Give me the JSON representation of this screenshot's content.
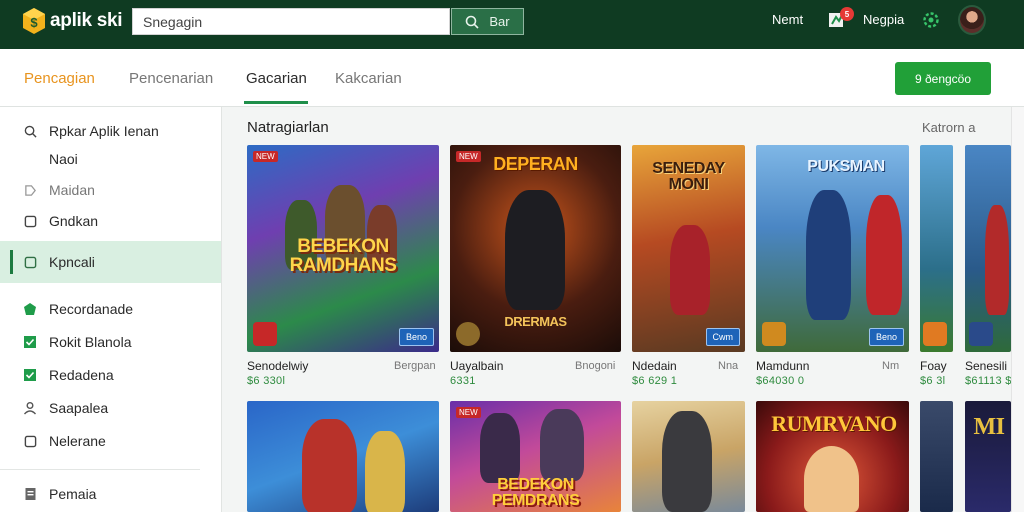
{
  "app": {
    "name": "aplik ski"
  },
  "search": {
    "value": "Snegagin",
    "button_label": "Bar"
  },
  "topnav": {
    "link1": "Nemt",
    "notif_count": "5",
    "link2": "Negpia"
  },
  "tabs": [
    {
      "label": "Pencagian"
    },
    {
      "label": "Pencenarian"
    },
    {
      "label": "Gacarian"
    },
    {
      "label": "Kakcarian"
    }
  ],
  "cta_label": "9 ðengcöo",
  "sidebar": {
    "items": [
      {
        "label": "Rpkar Aplik Ienan",
        "icon": "search-icon"
      },
      {
        "label": "Naoi",
        "icon": ""
      },
      {
        "label": "Maidan",
        "icon": "tag-icon"
      },
      {
        "label": "Gndkan",
        "icon": "square-icon"
      },
      {
        "label": "Kpncali",
        "icon": "square-icon"
      },
      {
        "label": "Recordanade",
        "icon": "shield-icon"
      },
      {
        "label": "Rokit Blanola",
        "icon": "square-check-icon"
      },
      {
        "label": "Redadena",
        "icon": "square-check-icon"
      },
      {
        "label": "Saapalea",
        "icon": "person-icon"
      },
      {
        "label": "Nelerane",
        "icon": "square-icon"
      },
      {
        "label": "Pemaia",
        "icon": "doc-icon"
      }
    ]
  },
  "section": {
    "title": "Natragiarlan",
    "see_all": "Katrorn a"
  },
  "games_row1": [
    {
      "art_title": "BEBEKON RAMDHANS",
      "tag": "NEW",
      "badge": "Beno",
      "name": "Senodelwiy",
      "sub": "Bergpan",
      "price": "$6 330l"
    },
    {
      "art_title": "DEPERAN",
      "art_title2": "DRERMAS",
      "tag": "NEW",
      "badge": "",
      "name": "Uayalbain",
      "sub": "Bnogoni",
      "price": "6331"
    },
    {
      "art_title": "SENEDAY MONI",
      "tag": "",
      "badge": "Cwm",
      "name": "Ndedain",
      "sub": "Nna",
      "price": "$6 629 1"
    },
    {
      "art_title": "PUKSMAN",
      "tag": "",
      "badge": "Beno",
      "name": "Mamdunn",
      "sub": "Nm",
      "price": "$64030 0"
    },
    {
      "art_title": "",
      "tag": "",
      "badge": "",
      "name": "Foay",
      "sub": "",
      "price": "$6 3l"
    },
    {
      "art_title": "",
      "tag": "",
      "badge": "",
      "name": "Senesili",
      "sub": "",
      "price": "$61113 $"
    }
  ],
  "games_row2": [
    {
      "art_title": "",
      "tag": "",
      "badge": ""
    },
    {
      "art_title": "BEDEKON PEMDRANS",
      "tag": "NEW",
      "badge": ""
    },
    {
      "art_title": "",
      "tag": "",
      "badge": ""
    },
    {
      "art_title": "RUMRVANO",
      "tag": "",
      "badge": ""
    },
    {
      "art_title": "",
      "tag": "",
      "badge": ""
    },
    {
      "art_title": "MI",
      "tag": "",
      "badge": ""
    }
  ]
}
